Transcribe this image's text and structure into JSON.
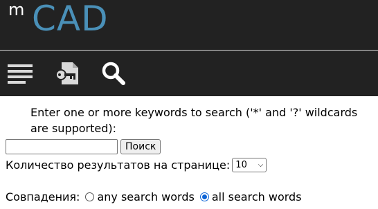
{
  "logo": {
    "prefix": "m",
    "name": "CAD"
  },
  "toolbar": {
    "icons": [
      "menu-icon",
      "key-document-icon",
      "search-icon"
    ]
  },
  "search": {
    "intro": "Enter one or more keywords to search ('*' and '?' wildcards are supported):",
    "input_value": "",
    "button_label": "Поиск",
    "results_per_page_label": "Количество результатов на странице:",
    "results_per_page_value": "10",
    "match_label": "Совпадения:",
    "match_options": [
      {
        "label": "any search words",
        "checked": false
      },
      {
        "label": "all search words",
        "checked": true
      }
    ]
  },
  "colors": {
    "header_bg": "#222222",
    "logo_accent": "#4a90b8",
    "radio_accent": "#0b63d6"
  }
}
